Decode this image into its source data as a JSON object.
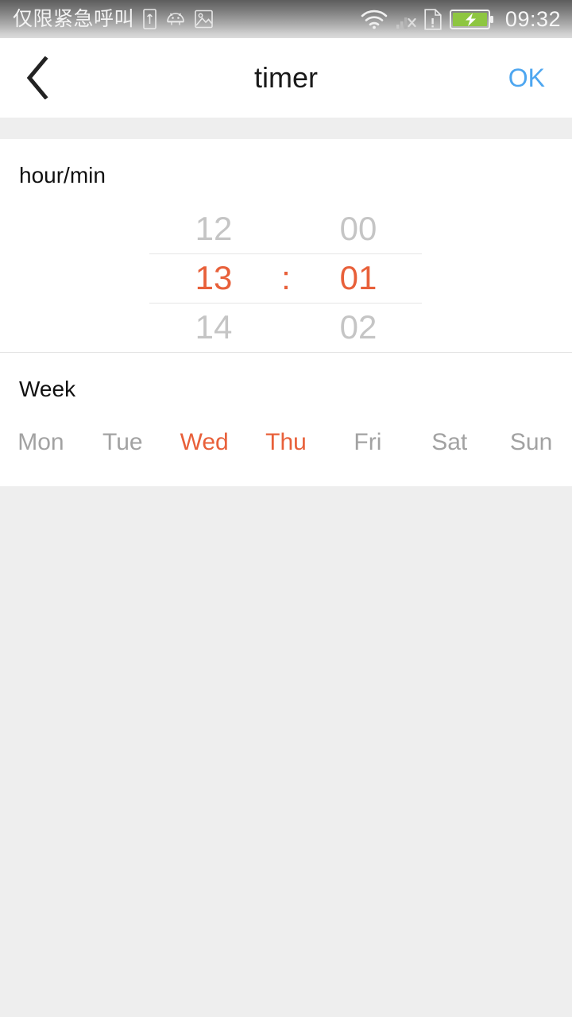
{
  "status_bar": {
    "carrier_text": "仅限紧急呼叫",
    "left_icons": [
      "usb-icon",
      "android-robot-icon",
      "screenshot-image-icon"
    ],
    "right_icons": [
      "wifi-icon",
      "no-signal-icon",
      "sim-alert-icon",
      "battery-charging-icon"
    ],
    "clock": "09:32",
    "battery_color": "#8ec641"
  },
  "header": {
    "back_icon": "chevron-left-icon",
    "title": "timer",
    "ok_label": "OK",
    "ok_color": "#4da6f0"
  },
  "hour_min_section": {
    "label": "hour/min",
    "separator": ":",
    "hours": {
      "previous": "12",
      "selected": "13",
      "next": "14"
    },
    "minutes": {
      "previous": "00",
      "selected": "01",
      "next": "02"
    },
    "selected_color": "#e8603a",
    "dim_color": "#c5c5c5"
  },
  "week_section": {
    "label": "Week",
    "days": [
      {
        "label": "Mon",
        "selected": false
      },
      {
        "label": "Tue",
        "selected": false
      },
      {
        "label": "Wed",
        "selected": true
      },
      {
        "label": "Thu",
        "selected": true
      },
      {
        "label": "Fri",
        "selected": false
      },
      {
        "label": "Sat",
        "selected": false
      },
      {
        "label": "Sun",
        "selected": false
      }
    ]
  }
}
